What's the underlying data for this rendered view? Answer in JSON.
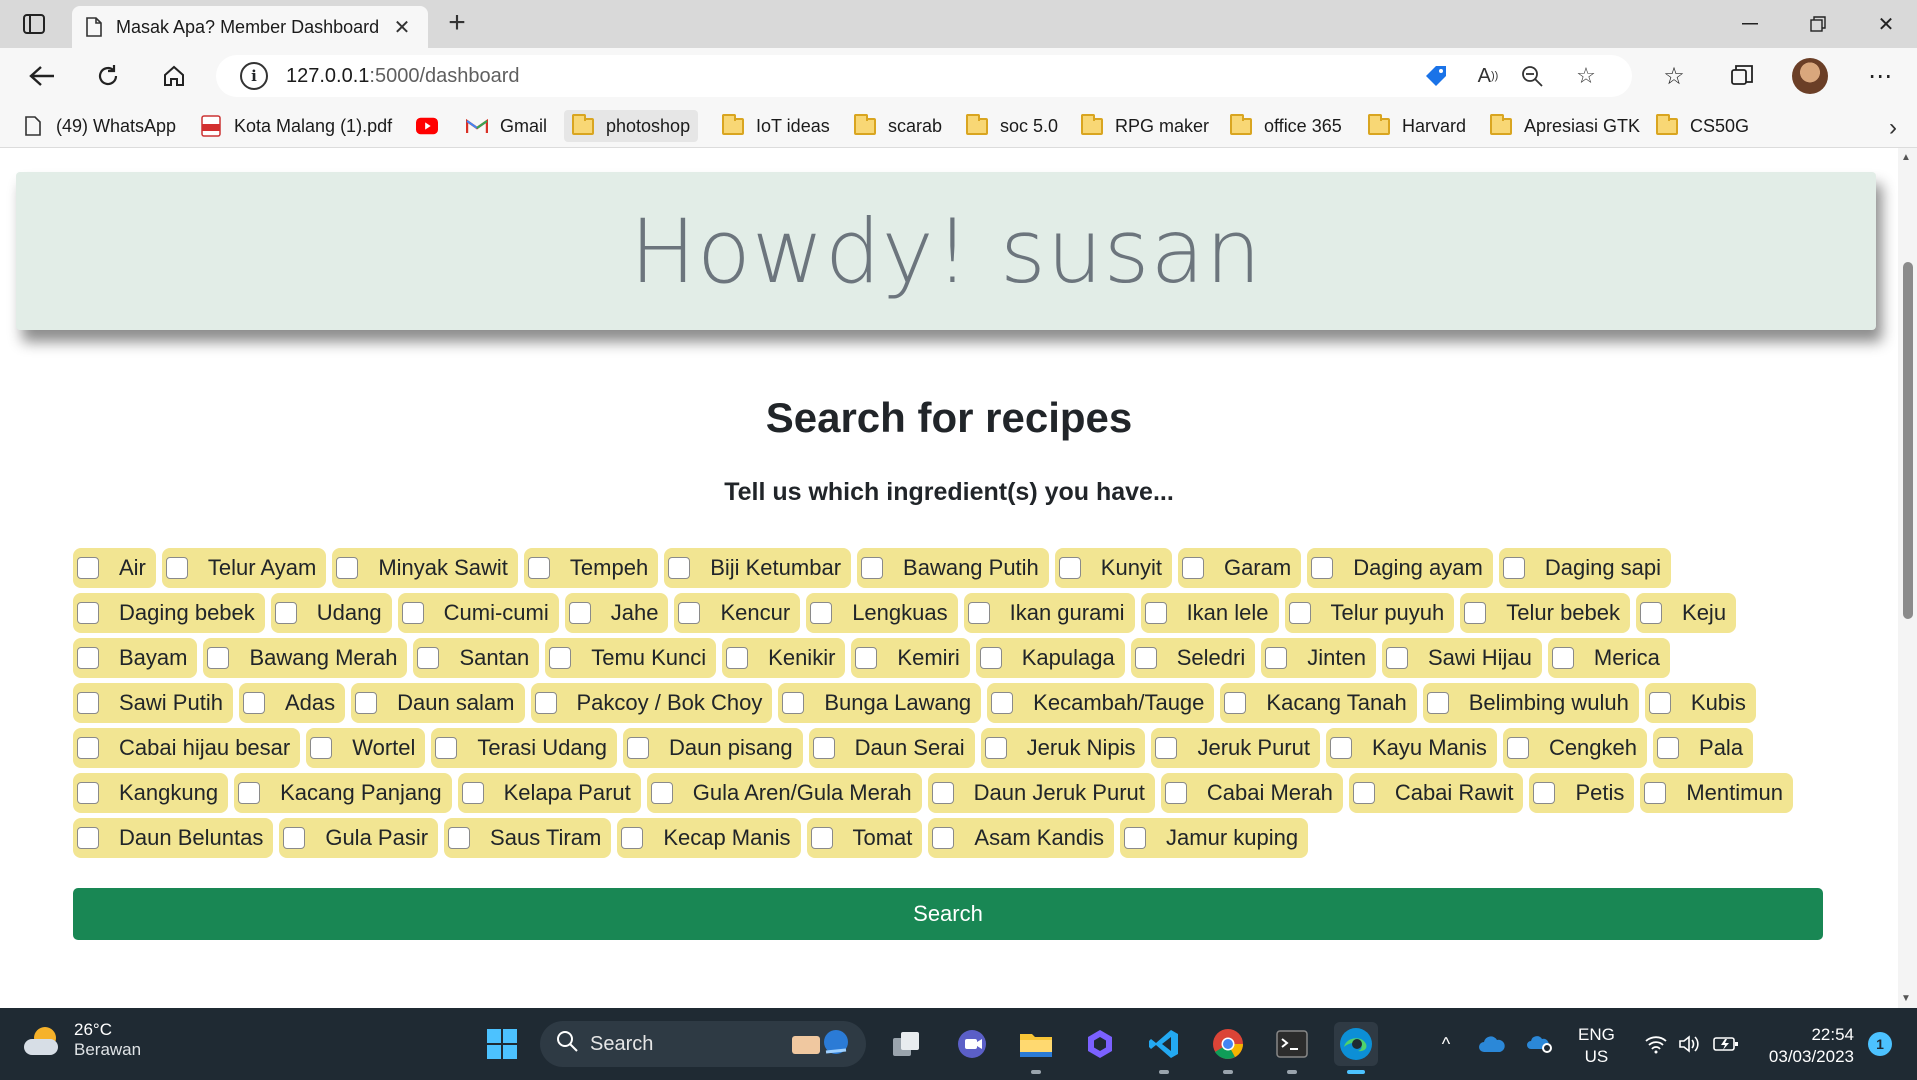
{
  "browser": {
    "tab_title": "Masak Apa? Member Dashboard",
    "url_host": "127.0.0.1",
    "url_path": ":5000/dashboard",
    "bookmarks": [
      {
        "label": "(49) WhatsApp",
        "icon": "page-icon"
      },
      {
        "label": "Kota Malang (1).pdf",
        "icon": "pdf-icon"
      },
      {
        "label": "",
        "icon": "youtube-icon"
      },
      {
        "label": "Gmail",
        "icon": "gmail-icon"
      },
      {
        "label": "photoshop",
        "icon": "folder-icon"
      },
      {
        "label": "IoT ideas",
        "icon": "folder-icon"
      },
      {
        "label": "scarab",
        "icon": "folder-icon"
      },
      {
        "label": "soc 5.0",
        "icon": "folder-icon"
      },
      {
        "label": "RPG maker",
        "icon": "folder-icon"
      },
      {
        "label": "office 365",
        "icon": "folder-icon"
      },
      {
        "label": "Harvard",
        "icon": "folder-icon"
      },
      {
        "label": "Apresiasi GTK",
        "icon": "folder-icon"
      },
      {
        "label": "CS50G",
        "icon": "folder-icon"
      }
    ]
  },
  "page": {
    "greeting": "Howdy! susan",
    "search_title": "Search for recipes",
    "search_subtitle": "Tell us which ingredient(s) you have...",
    "search_button": "Search",
    "ingredients": [
      "Air",
      "Telur Ayam",
      "Minyak Sawit",
      "Tempeh",
      "Biji Ketumbar",
      "Bawang Putih",
      "Kunyit",
      "Garam",
      "Daging ayam",
      "Daging sapi",
      "Daging bebek",
      "Udang",
      "Cumi-cumi",
      "Jahe",
      "Kencur",
      "Lengkuas",
      "Ikan gurami",
      "Ikan lele",
      "Telur puyuh",
      "Telur bebek",
      "Keju",
      "Bayam",
      "Bawang Merah",
      "Santan",
      "Temu Kunci",
      "Kenikir",
      "Kemiri",
      "Kapulaga",
      "Seledri",
      "Jinten",
      "Sawi Hijau",
      "Merica",
      "Sawi Putih",
      "Adas",
      "Daun salam",
      "Pakcoy / Bok Choy",
      "Bunga Lawang",
      "Kecambah/Tauge",
      "Kacang Tanah",
      "Belimbing wuluh",
      "Kubis",
      "Cabai hijau besar",
      "Wortel",
      "Terasi Udang",
      "Daun pisang",
      "Daun Serai",
      "Jeruk Nipis",
      "Jeruk Purut",
      "Kayu Manis",
      "Cengkeh",
      "Pala",
      "Kangkung",
      "Kacang Panjang",
      "Kelapa Parut",
      "Gula Aren/Gula Merah",
      "Daun Jeruk Purut",
      "Cabai Merah",
      "Cabai Rawit",
      "Petis",
      "Mentimun",
      "Daun Beluntas",
      "Gula Pasir",
      "Saus Tiram",
      "Kecap Manis",
      "Tomat",
      "Asam Kandis",
      "Jamur kuping"
    ]
  },
  "taskbar": {
    "temperature": "26°C",
    "weather": "Berawan",
    "search_placeholder": "Search",
    "lang_line1": "ENG",
    "lang_line2": "US",
    "time": "22:54",
    "date": "03/03/2023",
    "notification_count": "1"
  },
  "colors": {
    "jumbotron_bg": "#e2ede7",
    "ingredient_bg": "#f2e592",
    "search_button_bg": "#198754",
    "taskbar_bg": "#1f2a33"
  }
}
